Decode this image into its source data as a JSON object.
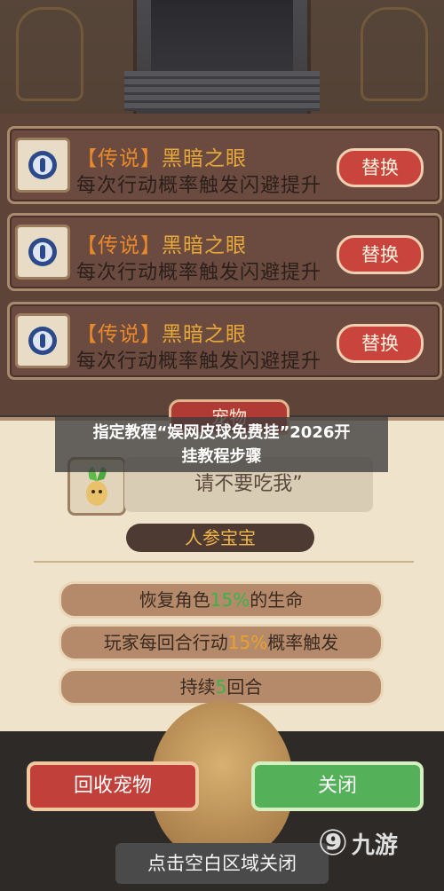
{
  "buff_list": {
    "items": [
      {
        "tag": "【传说】",
        "name": "黑暗之眼",
        "desc": "每次行动概率触发闪避提升",
        "button": "替换",
        "icon": "eye-icon"
      },
      {
        "tag": "【传说】",
        "name": "黑暗之眼",
        "desc": "每次行动概率触发闪避提升",
        "button": "替换",
        "icon": "eye-icon"
      },
      {
        "tag": "【传说】",
        "name": "黑暗之眼",
        "desc": "每次行动概率触发闪避提升",
        "button": "替换",
        "icon": "eye-icon"
      }
    ]
  },
  "pet_dialog": {
    "tab": "宠物",
    "speech": "请不要吃我”",
    "pet_name": "人参宝宝",
    "stats": [
      {
        "pre": "恢复角色",
        "hl": "15%",
        "post": "的生命"
      },
      {
        "pre": "玩家每回合行动",
        "hl": "15%",
        "post": "概率触发"
      },
      {
        "pre": "持续",
        "hl": "5",
        "post": "回合"
      }
    ],
    "recycle_button": "回收宠物",
    "close_button": "关闭",
    "hint": "点击空白区域关闭"
  },
  "overlay": {
    "line1": "指定教程“娱网皮球免费挂”2026开",
    "line2": "挂教程步骤"
  },
  "watermark": {
    "text": "九游"
  },
  "colors": {
    "accent_red": "#c9443c",
    "accent_green": "#55b05a",
    "legend_orange": "#e88a2c"
  }
}
